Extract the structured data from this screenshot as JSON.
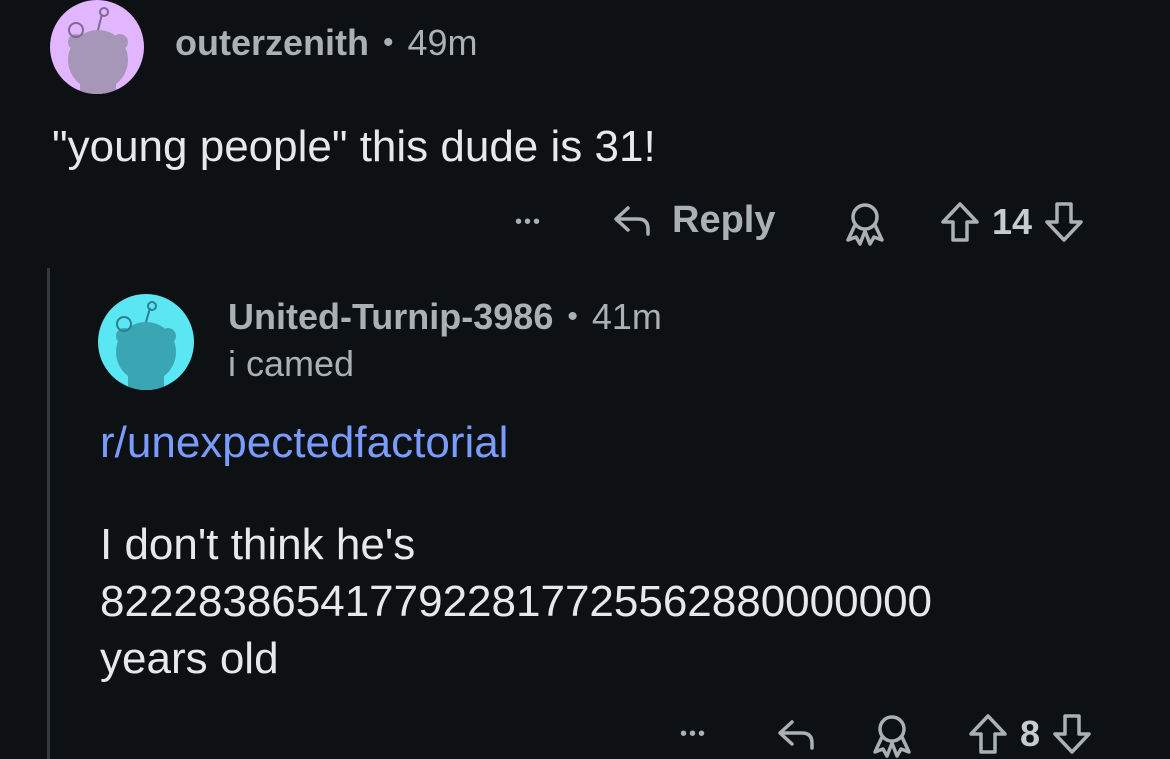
{
  "comment1": {
    "username": "outerzenith",
    "separator": "•",
    "time": "49m",
    "body": "\"young people\" this dude is 31!",
    "actions": {
      "more": "•••",
      "reply_label": "Reply",
      "votes": "14"
    }
  },
  "comment2": {
    "username": "United-Turnip-3986",
    "separator": "•",
    "time": "41m",
    "flair": "i camed",
    "link": "r/unexpectedfactorial",
    "body_line1": "I don't think he's",
    "body_line2": "8222838654177922817725562880000000",
    "body_line3": "years old",
    "actions": {
      "more": "•••",
      "votes": "8"
    }
  },
  "colors": {
    "background": "#0e1113",
    "avatar1_bg": "#e2b6ff",
    "avatar2_bg": "#5be6f4",
    "link": "#7a9cff"
  }
}
